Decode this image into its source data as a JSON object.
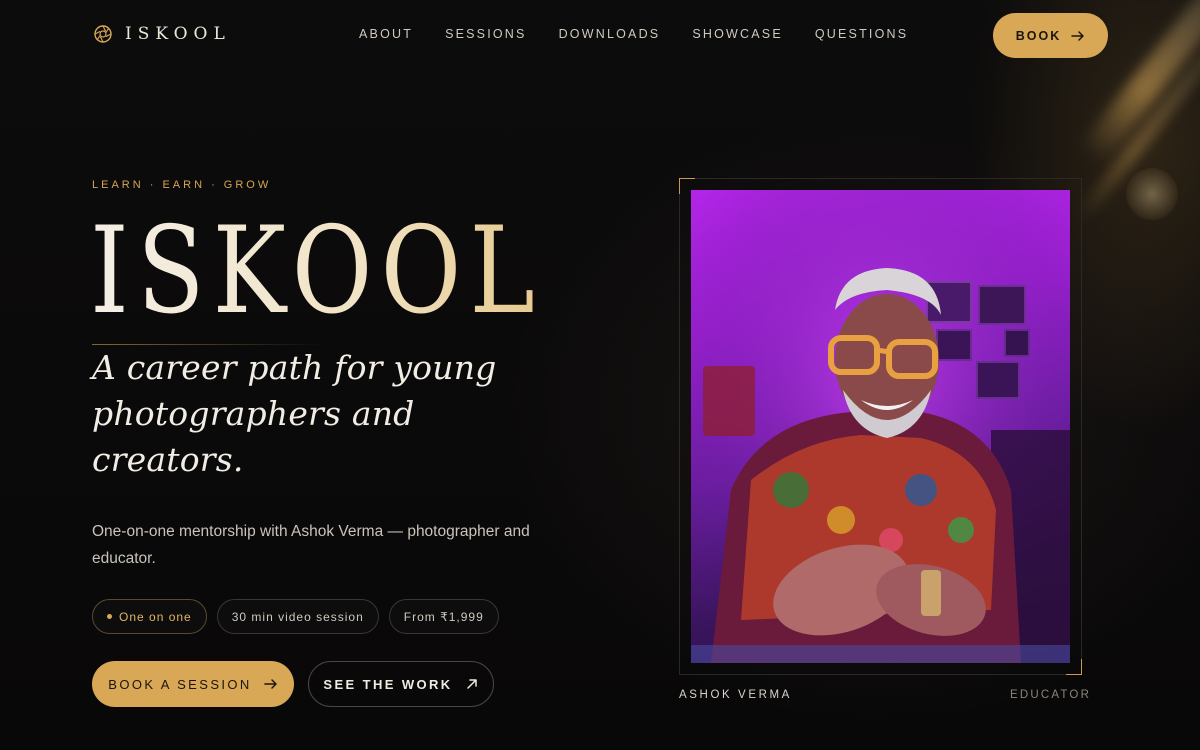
{
  "brand": {
    "name": "ISKOOL",
    "logo_icon": "aperture-icon",
    "accent": "#d9a856"
  },
  "nav": {
    "links": [
      "ABOUT",
      "SESSIONS",
      "DOWNLOADS",
      "SHOWCASE",
      "QUESTIONS"
    ],
    "cta_label": "BOOK"
  },
  "hero": {
    "eyebrow": "LEARN · EARN · GROW",
    "title": "ISKOOL",
    "tagline": "A career path for young photographers and creators.",
    "subcopy": "One-on-one mentorship with Ashok Verma — photographer and educator.",
    "pills": [
      "One on one",
      "30 min video session",
      "From ₹1,999"
    ],
    "primary_cta": "BOOK A SESSION",
    "secondary_cta": "SEE THE WORK"
  },
  "portrait": {
    "name": "ASHOK VERMA",
    "role": "EDUCATOR"
  }
}
